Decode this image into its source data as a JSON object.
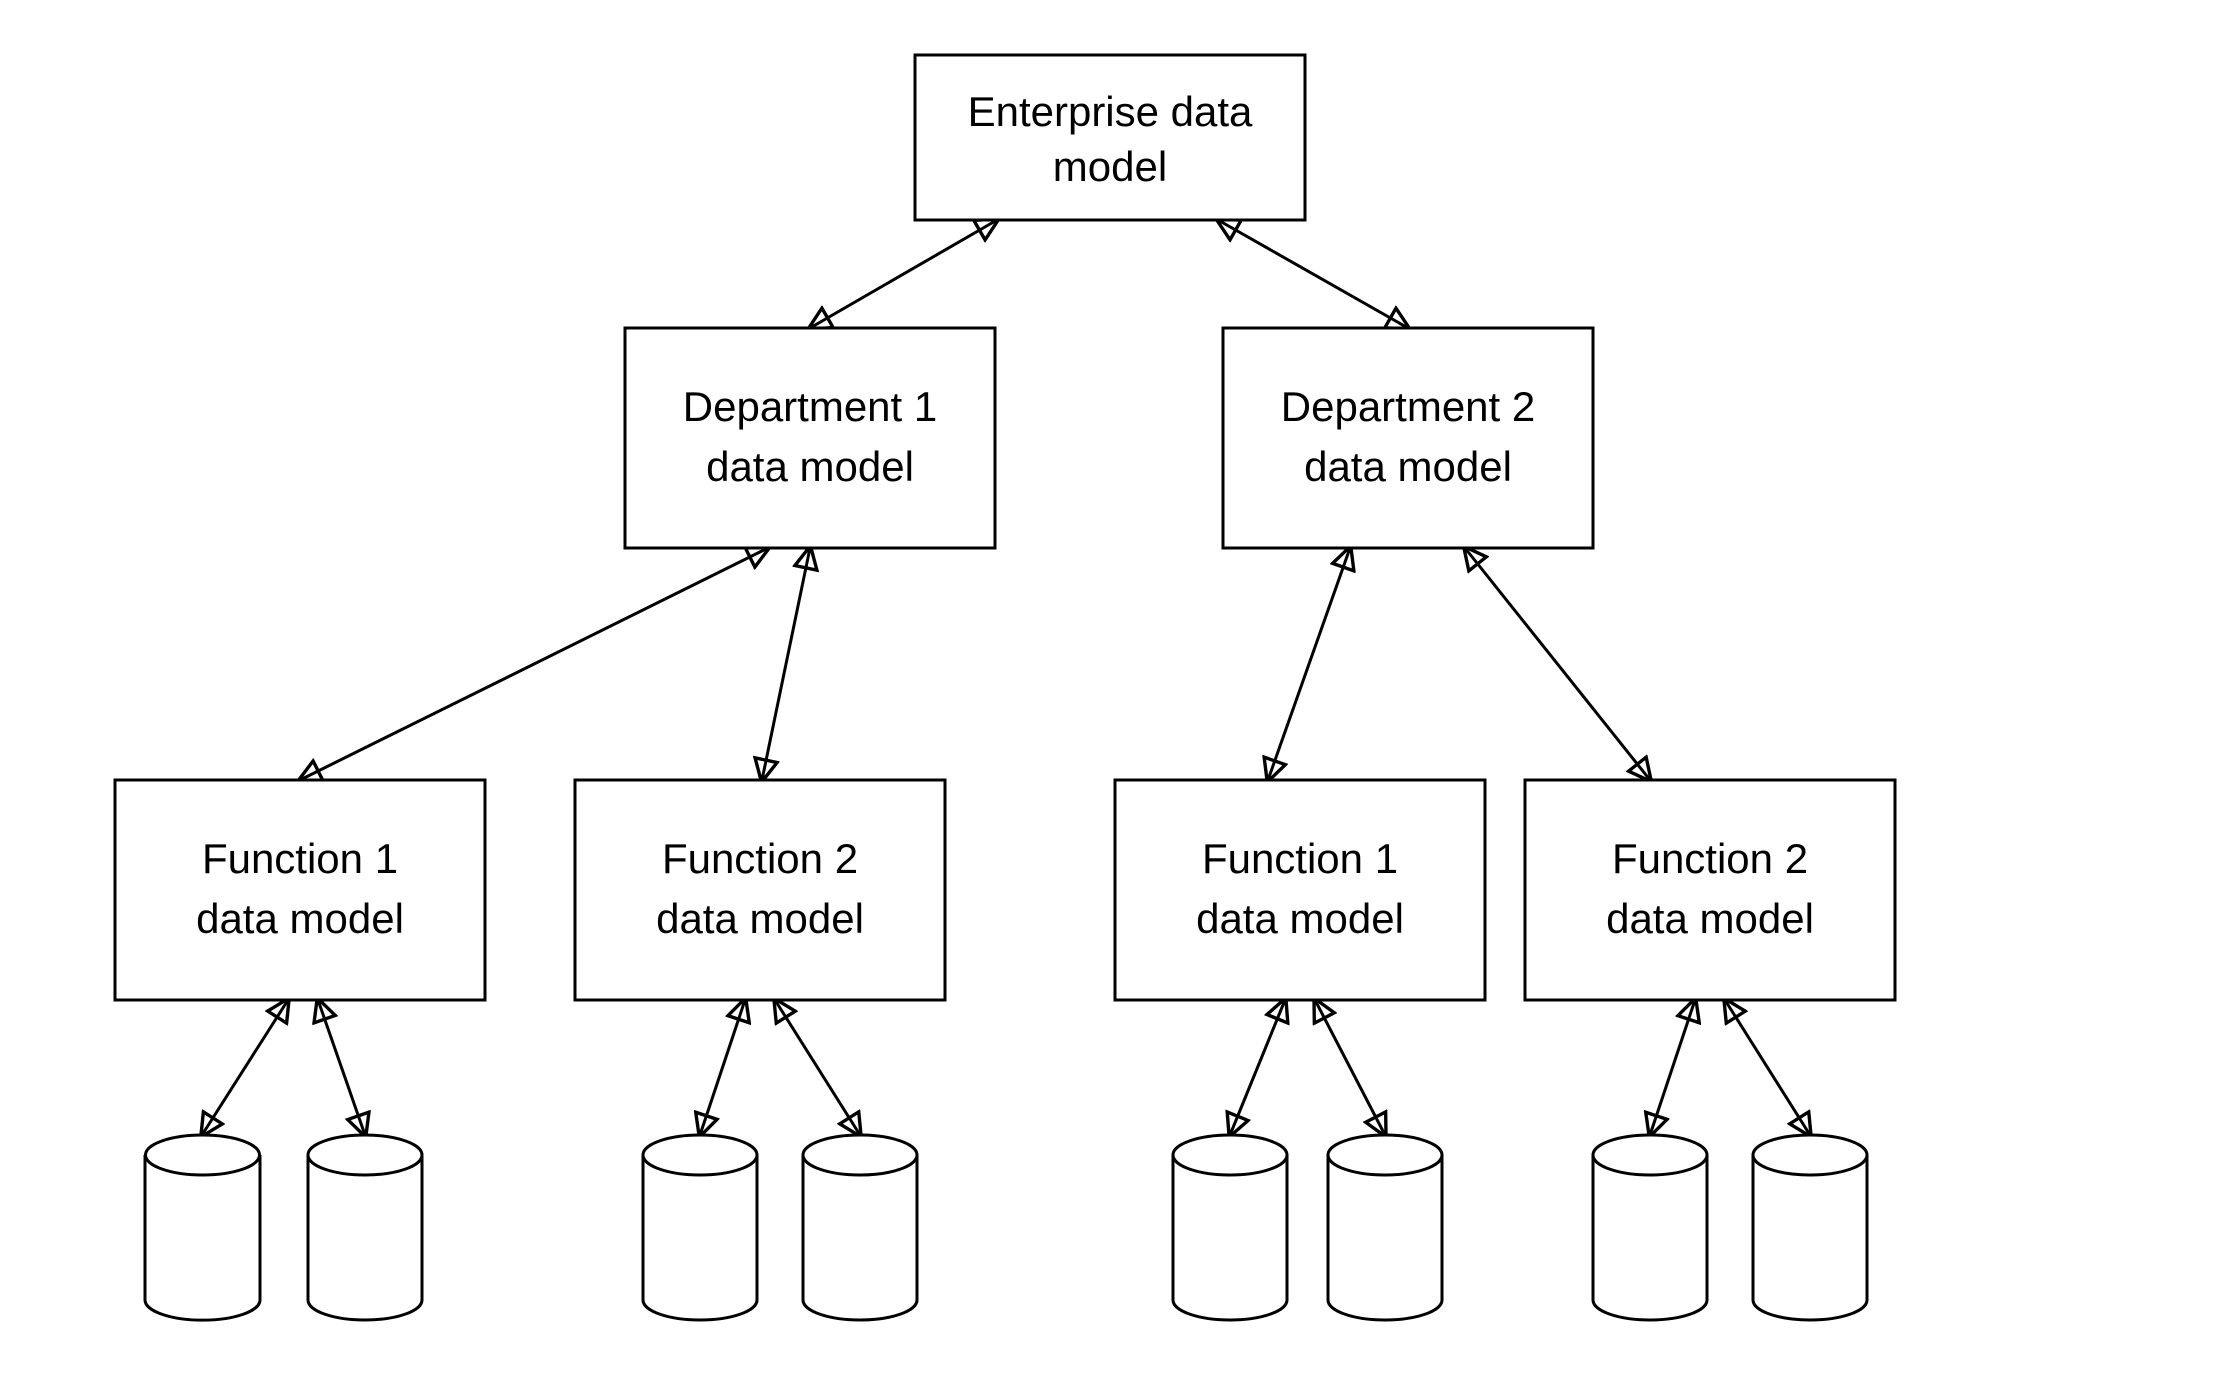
{
  "nodes": {
    "root": {
      "line1": "Enterprise data",
      "line2": "model"
    },
    "dept1": {
      "line1": "Department 1",
      "line2": "data model"
    },
    "dept2": {
      "line1": "Department 2",
      "line2": "data model"
    },
    "f11": {
      "line1": "Function 1",
      "line2": "data model"
    },
    "f12": {
      "line1": "Function 2",
      "line2": "data model"
    },
    "f21": {
      "line1": "Function 1",
      "line2": "data model"
    },
    "f22": {
      "line1": "Function 2",
      "line2": "data model"
    }
  }
}
